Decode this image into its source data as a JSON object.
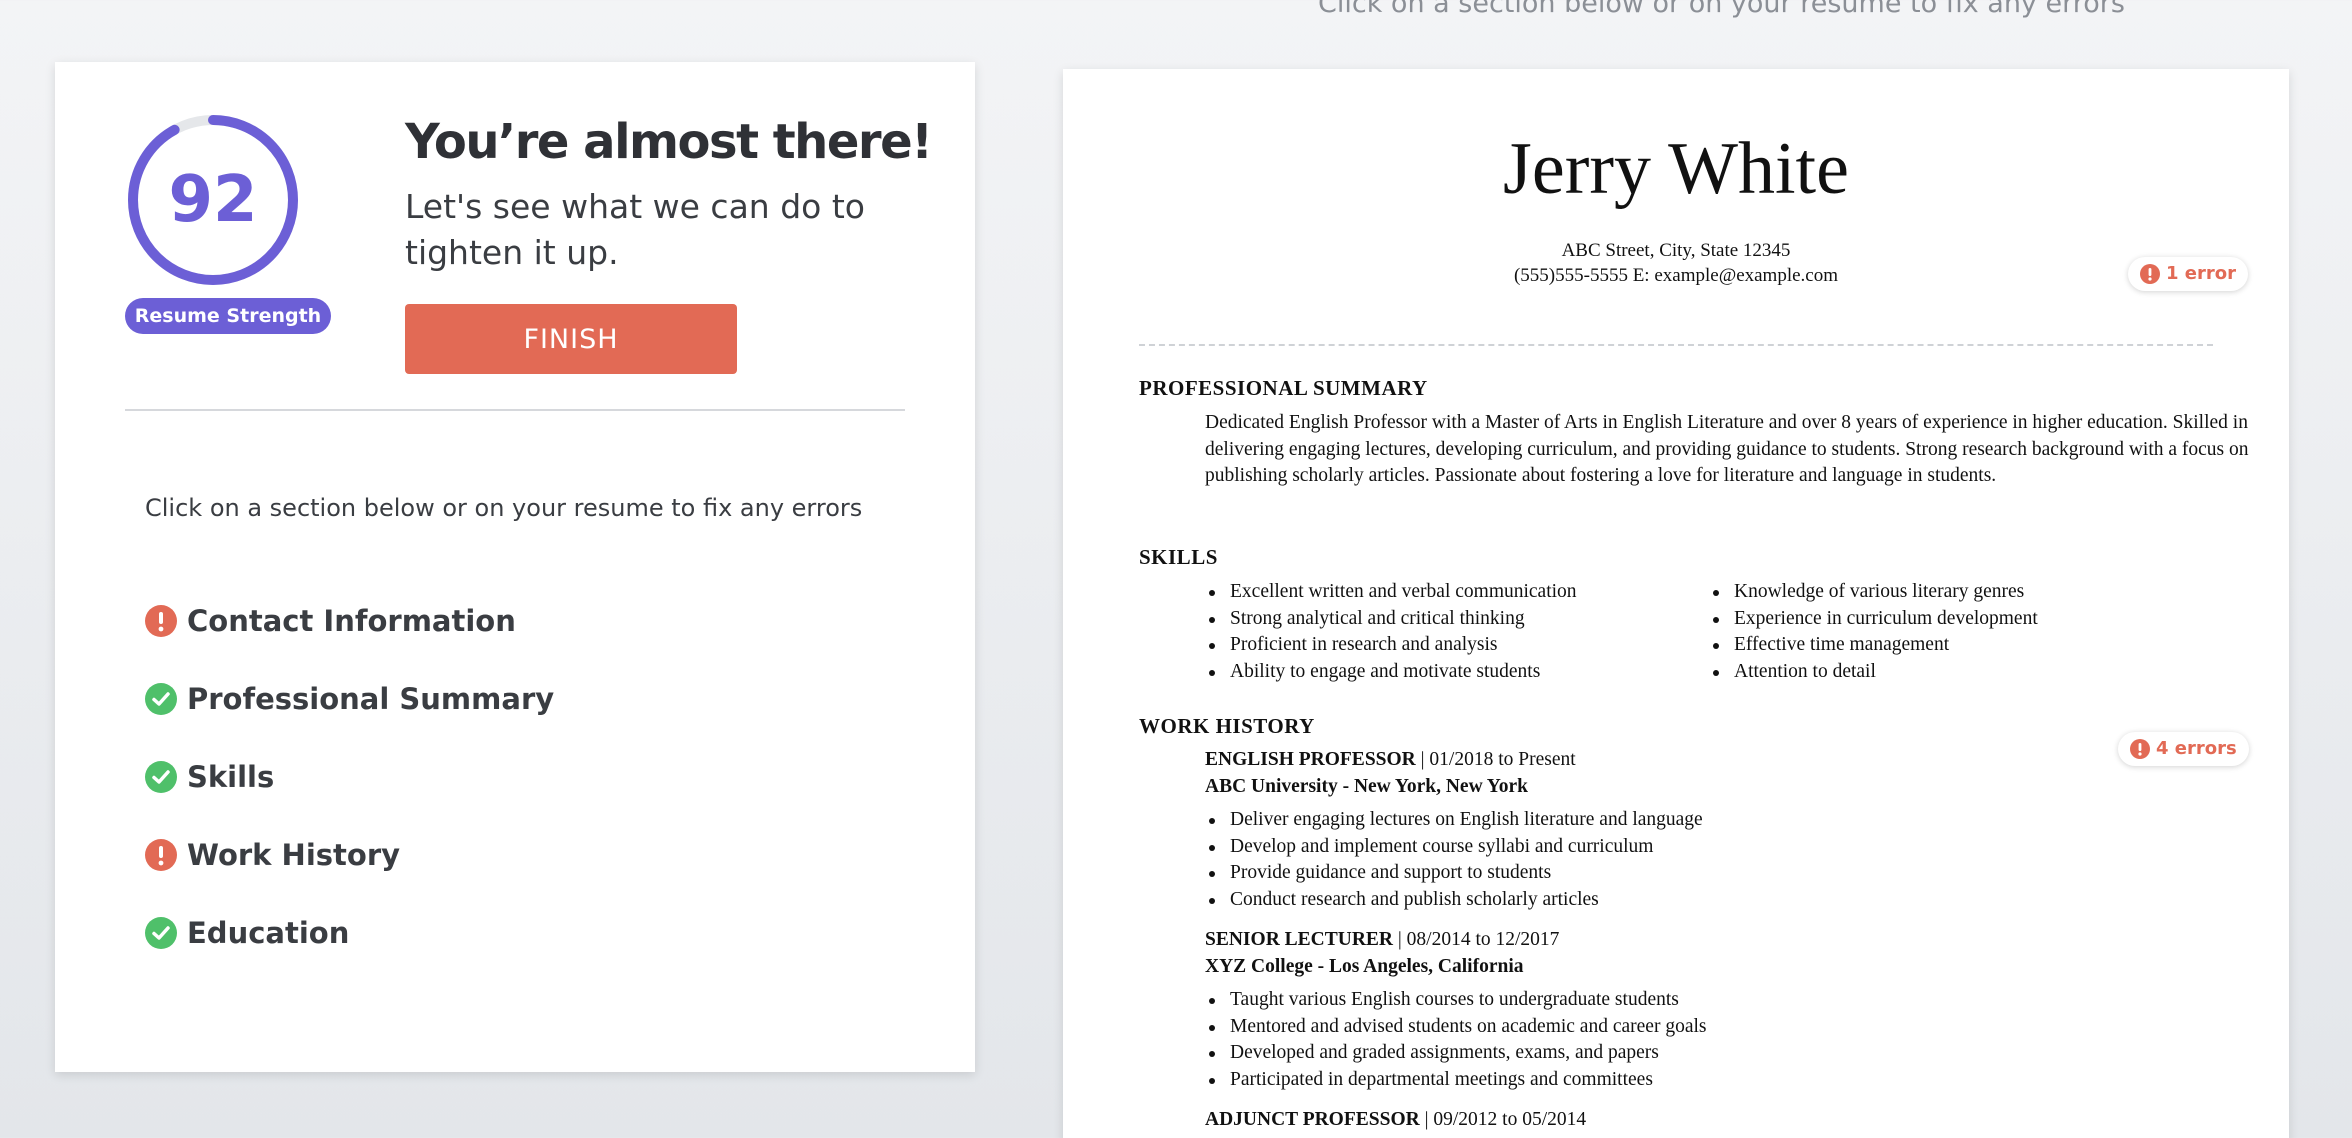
{
  "header": {
    "hint": "Click on a section below or on your resume to fix any errors"
  },
  "score": {
    "value": "92",
    "progress_fraction": 0.92,
    "label": "Resume Strength"
  },
  "left": {
    "headline": "You’re almost there!",
    "subhead": "Let's see what we can do to tighten it up.",
    "finish_label": "FINISH",
    "instruction": "Click on a section below or on your resume to fix any errors",
    "sections": [
      {
        "label": "Contact Information",
        "status": "error"
      },
      {
        "label": "Professional Summary",
        "status": "ok"
      },
      {
        "label": "Skills",
        "status": "ok"
      },
      {
        "label": "Work History",
        "status": "error"
      },
      {
        "label": "Education",
        "status": "ok"
      }
    ]
  },
  "colors": {
    "accent": "#6c5fd6",
    "error": "#e26a55",
    "ok": "#4fc06a"
  },
  "resume": {
    "name": "Jerry White",
    "address": "ABC Street, City, State 12345",
    "phone_email": "(555)555-5555 E: example@example.com",
    "contact_error_badge": "1 error",
    "work_error_badge": "4 errors",
    "summary_heading": "PROFESSIONAL SUMMARY",
    "summary": "Dedicated English Professor with a Master of Arts in English Literature and over 8 years of experience in higher education. Skilled in delivering engaging lectures, developing curriculum, and providing guidance to students. Strong research background with a focus on publishing scholarly articles. Passionate about fostering a love for literature and language in students.",
    "skills_heading": "SKILLS",
    "skills_left": [
      "Excellent written and verbal communication",
      "Strong analytical and critical thinking",
      "Proficient in research and analysis",
      "Ability to engage and motivate students"
    ],
    "skills_right": [
      "Knowledge of various literary genres",
      "Experience in curriculum development",
      "Effective time management",
      "Attention to detail"
    ],
    "work_heading": "WORK HISTORY",
    "jobs": [
      {
        "title": "ENGLISH PROFESSOR",
        "dates": " | 01/2018 to Present",
        "company": "ABC University - New York, New York",
        "bullets": [
          "Deliver engaging lectures on English literature and language",
          "Develop and implement course syllabi and curriculum",
          "Provide guidance and support to students",
          "Conduct research and publish scholarly articles"
        ]
      },
      {
        "title": "SENIOR LECTURER",
        "dates": " | 08/2014 to 12/2017",
        "company": "XYZ College - Los Angeles, California",
        "bullets": [
          "Taught various English courses to undergraduate students",
          "Mentored and advised students on academic and career goals",
          "Developed and graded assignments, exams, and papers",
          "Participated in departmental meetings and committees"
        ]
      },
      {
        "title": "ADJUNCT PROFESSOR",
        "dates": " | 09/2012 to 05/2014"
      }
    ]
  }
}
